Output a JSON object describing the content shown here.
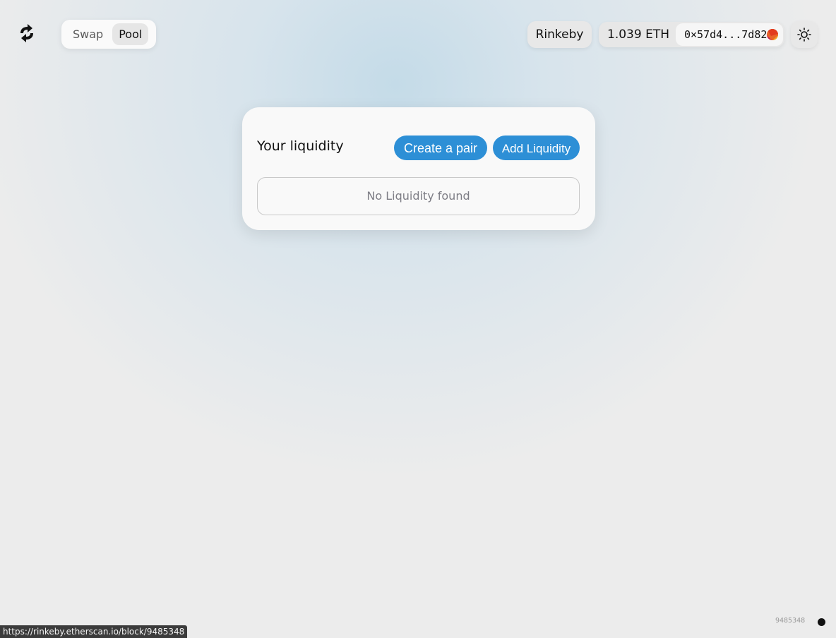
{
  "nav": {
    "tabs": [
      {
        "label": "Swap",
        "active": false
      },
      {
        "label": "Pool",
        "active": true
      }
    ]
  },
  "header": {
    "network": "Rinkeby",
    "balance": "1.039 ETH",
    "address": "0×57d4...7d82",
    "theme_icon": "sun-icon",
    "logo_icon": "swap-arrows-icon"
  },
  "pool": {
    "title": "Your liquidity",
    "create_pair_label": "Create a pair",
    "add_liquidity_label": "Add Liquidity",
    "empty_text": "No Liquidity found"
  },
  "footer": {
    "block_number": "9485348",
    "status_url": "https://rinkeby.etherscan.io/block/9485348"
  },
  "colors": {
    "primary": "#2d8fd6",
    "background": "#ececec",
    "card": "#f9f9f9"
  }
}
